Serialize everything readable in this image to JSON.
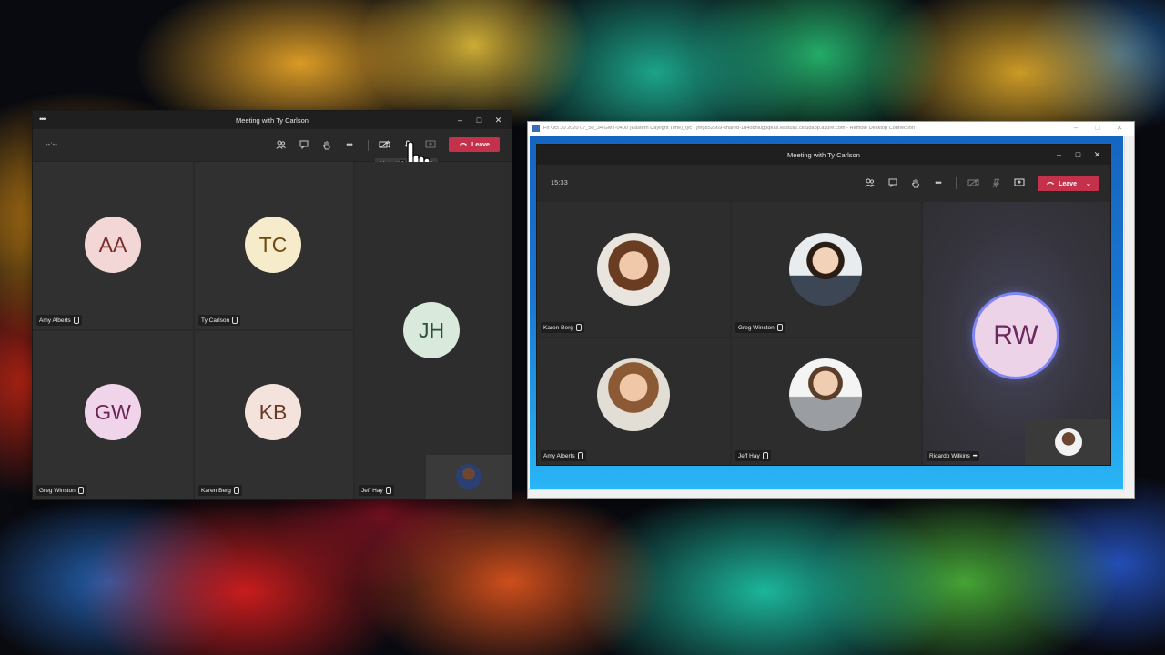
{
  "left_window": {
    "title": "Meeting with Ty Carlson",
    "timer": "--:--",
    "leave_label": "Leave",
    "tooltip": "Mute (Ctrl+Shift+M)",
    "participants": [
      {
        "initials": "AA",
        "name": "Amy Alberts",
        "bg": "#f3d6d6",
        "fg": "#7a2b2b"
      },
      {
        "initials": "TC",
        "name": "Ty Carlson",
        "bg": "#f6ebcb",
        "fg": "#6b4b10"
      },
      {
        "initials": "JH",
        "name": "Jeff Hay",
        "bg": "#d9e9dc",
        "fg": "#2c5136"
      },
      {
        "initials": "GW",
        "name": "Greg Winston",
        "bg": "#f0d5ea",
        "fg": "#6a2456"
      },
      {
        "initials": "KB",
        "name": "Karen Berg",
        "bg": "#f3e3dc",
        "fg": "#6a3a28"
      }
    ]
  },
  "rdp_window": {
    "title": "Fri Oct 30 2020 07_50_34 GMT-0400 (Eastern Daylight Time)_tyc - jhrg852669-shared-1h4obnlugpqeas.eastus2.cloudapp.azure.com - Remote Desktop Connection"
  },
  "right_window": {
    "title": "Meeting with Ty Carlson",
    "timer": "15:33",
    "leave_label": "Leave",
    "participants": [
      {
        "name": "Karen Berg"
      },
      {
        "name": "Greg Winston"
      },
      {
        "name": "Amy Alberts"
      },
      {
        "name": "Jeff Hay"
      },
      {
        "name": "Ricardo Wilkins",
        "initials": "RW"
      }
    ]
  },
  "colors": {
    "leave": "#c4314b",
    "teams_bg": "#292929",
    "tile_bg": "#303030",
    "speaking_ring": "#7f85f5"
  }
}
